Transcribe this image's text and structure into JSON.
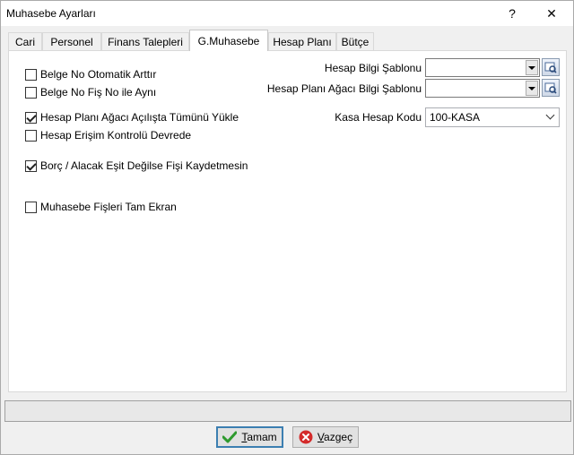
{
  "window": {
    "title": "Muhasebe Ayarları",
    "help_glyph": "?",
    "close_glyph": "✕"
  },
  "tabs": [
    {
      "label": "Cari"
    },
    {
      "label": "Personel"
    },
    {
      "label": "Finans Talepleri"
    },
    {
      "label": "G.Muhasebe",
      "active": true
    },
    {
      "label": "Hesap Planı"
    },
    {
      "label": "Bütçe"
    }
  ],
  "checkboxes": [
    {
      "label": "Belge No Otomatik Arttır",
      "checked": false
    },
    {
      "label": "Belge No Fiş No ile Aynı",
      "checked": false
    },
    {
      "label": "Hesap Planı Ağacı Açılışta Tümünü Yükle",
      "checked": true
    },
    {
      "label": "Hesap Erişim Kontrolü Devrede",
      "checked": false
    },
    {
      "label": "Borç / Alacak Eşit Değilse Fişi Kaydetmesin",
      "checked": true
    },
    {
      "label": "Muhasebe Fişleri Tam Ekran",
      "checked": false
    }
  ],
  "fields": {
    "hesap_bilgi_sablonu": {
      "label": "Hesap Bilgi Şablonu",
      "value": ""
    },
    "hesap_plani_agaci_bilgi_sablonu": {
      "label": "Hesap Planı Ağacı Bilgi Şablonu",
      "value": ""
    },
    "kasa_hesap_kodu": {
      "label": "Kasa Hesap Kodu",
      "value": "100-KASA"
    }
  },
  "buttons": {
    "ok_prefix": "",
    "ok_underlined": "T",
    "ok_rest": "amam",
    "cancel_underlined": "V",
    "cancel_rest": "azgeç"
  },
  "icons": {
    "ok": "check-icon",
    "cancel": "cancel-icon",
    "lookup": "lookup-icon"
  },
  "colors": {
    "ok_check": "#2e9a2e",
    "cancel_red": "#d42b2b",
    "default_border": "#3c7fb1"
  },
  "status": {
    "text": ""
  }
}
